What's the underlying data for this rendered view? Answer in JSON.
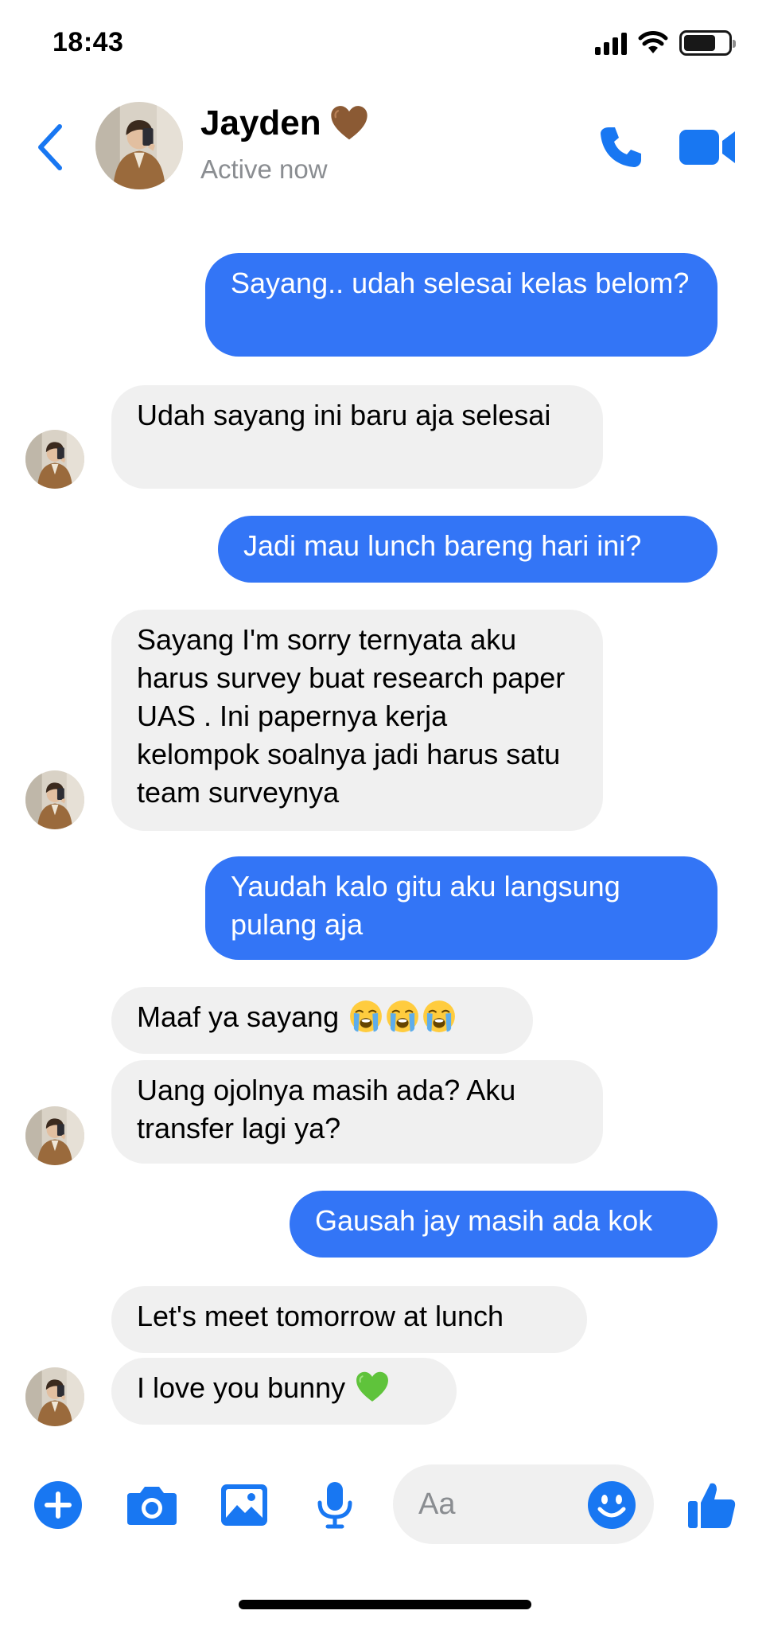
{
  "status_bar": {
    "time": "18:43",
    "battery_level": 0.72
  },
  "header": {
    "name": "Jayden",
    "name_emoji": "brown-heart",
    "status": "Active now",
    "accent": "#1877f2"
  },
  "messages": [
    {
      "side": "sent",
      "text": "Sayang.. udah selesai kelas belom?"
    },
    {
      "side": "received",
      "text": "Udah sayang ini baru aja selesai"
    },
    {
      "side": "sent",
      "text": "Jadi mau lunch bareng hari ini?"
    },
    {
      "side": "received",
      "text": "Sayang I'm sorry ternyata aku harus survey buat research paper UAS . Ini papernya kerja kelompok soalnya jadi harus satu team surveynya"
    },
    {
      "side": "sent",
      "text": "Yaudah kalo gitu aku langsung pulang aja"
    },
    {
      "side": "received",
      "text": "Maaf ya sayang",
      "emojis": [
        "crying-face",
        "crying-face",
        "crying-face"
      ]
    },
    {
      "side": "received",
      "text": "Uang ojolnya masih ada? Aku transfer lagi ya?"
    },
    {
      "side": "sent",
      "text": "Gausah jay masih ada kok"
    },
    {
      "side": "received",
      "text": "Let's meet tomorrow at lunch"
    },
    {
      "side": "received",
      "text": "I love you bunny",
      "emojis": [
        "green-heart"
      ]
    }
  ],
  "composer": {
    "placeholder": "Aa",
    "icons": [
      "plus-icon",
      "camera-icon",
      "image-icon",
      "microphone-icon",
      "emoji-icon",
      "thumbs-up-icon"
    ]
  },
  "colors": {
    "sent_bubble": "#3375f6",
    "received_bubble": "#f0f0f0",
    "accent": "#1877f2"
  }
}
